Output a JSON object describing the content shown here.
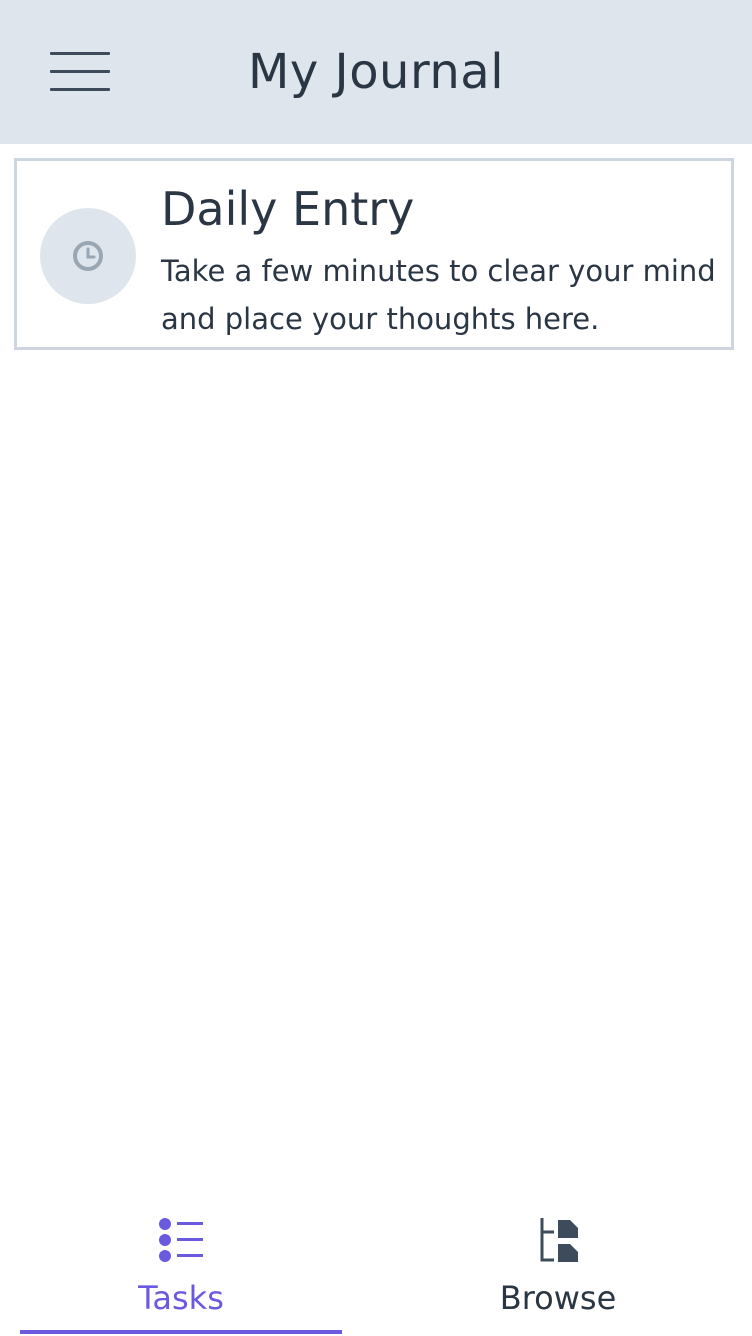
{
  "header": {
    "title": "My Journal",
    "menu_icon": "hamburger-menu-icon",
    "background": "#dfe5ed"
  },
  "entries": [
    {
      "title": "Daily Entry",
      "description": "Take a few minutes to clear your mind and place your thoughts here.",
      "icon": "clock-icon"
    }
  ],
  "tabs": [
    {
      "label": "Tasks",
      "icon": "task-list-icon",
      "active": true
    },
    {
      "label": "Browse",
      "icon": "browse-tree-icon",
      "active": false
    }
  ],
  "colors": {
    "accent": "#6a5ae0",
    "text": "#2a3644",
    "card_border": "#cdd6e0"
  }
}
